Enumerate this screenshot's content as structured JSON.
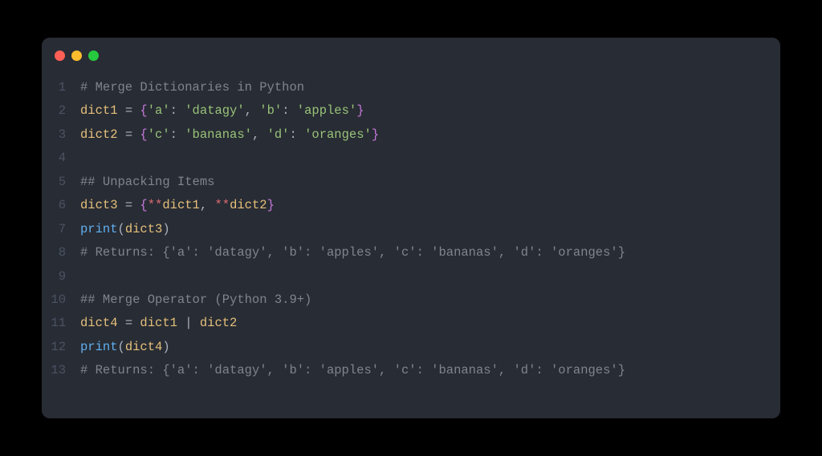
{
  "window": {
    "traffic_lights": [
      "red",
      "yellow",
      "green"
    ]
  },
  "code": {
    "lines": [
      {
        "n": "1",
        "tokens": [
          [
            "comment",
            "# Merge Dictionaries in Python"
          ]
        ]
      },
      {
        "n": "2",
        "tokens": [
          [
            "name",
            "dict1"
          ],
          [
            "op",
            " = "
          ],
          [
            "brace",
            "{"
          ],
          [
            "string",
            "'a'"
          ],
          [
            "punc",
            ": "
          ],
          [
            "string",
            "'datagy'"
          ],
          [
            "punc",
            ", "
          ],
          [
            "string",
            "'b'"
          ],
          [
            "punc",
            ": "
          ],
          [
            "string",
            "'apples'"
          ],
          [
            "brace",
            "}"
          ]
        ]
      },
      {
        "n": "3",
        "tokens": [
          [
            "name",
            "dict2"
          ],
          [
            "op",
            " = "
          ],
          [
            "brace",
            "{"
          ],
          [
            "string",
            "'c'"
          ],
          [
            "punc",
            ": "
          ],
          [
            "string",
            "'bananas'"
          ],
          [
            "punc",
            ", "
          ],
          [
            "string",
            "'d'"
          ],
          [
            "punc",
            ": "
          ],
          [
            "string",
            "'oranges'"
          ],
          [
            "brace",
            "}"
          ]
        ]
      },
      {
        "n": "4",
        "tokens": []
      },
      {
        "n": "5",
        "tokens": [
          [
            "comment",
            "## Unpacking Items"
          ]
        ]
      },
      {
        "n": "6",
        "tokens": [
          [
            "name",
            "dict3"
          ],
          [
            "op",
            " = "
          ],
          [
            "brace",
            "{"
          ],
          [
            "star",
            "**"
          ],
          [
            "name",
            "dict1"
          ],
          [
            "punc",
            ", "
          ],
          [
            "star",
            "**"
          ],
          [
            "name",
            "dict2"
          ],
          [
            "brace",
            "}"
          ]
        ]
      },
      {
        "n": "7",
        "tokens": [
          [
            "func",
            "print"
          ],
          [
            "punc",
            "("
          ],
          [
            "name",
            "dict3"
          ],
          [
            "punc",
            ")"
          ]
        ]
      },
      {
        "n": "8",
        "tokens": [
          [
            "comment",
            "# Returns: {'a': 'datagy', 'b': 'apples', 'c': 'bananas', 'd': 'oranges'}"
          ]
        ]
      },
      {
        "n": "9",
        "tokens": []
      },
      {
        "n": "10",
        "tokens": [
          [
            "comment",
            "## Merge Operator (Python 3.9+)"
          ]
        ]
      },
      {
        "n": "11",
        "tokens": [
          [
            "name",
            "dict4"
          ],
          [
            "op",
            " = "
          ],
          [
            "name",
            "dict1"
          ],
          [
            "pipe",
            " | "
          ],
          [
            "name",
            "dict2"
          ]
        ]
      },
      {
        "n": "12",
        "tokens": [
          [
            "func",
            "print"
          ],
          [
            "punc",
            "("
          ],
          [
            "name",
            "dict4"
          ],
          [
            "punc",
            ")"
          ]
        ]
      },
      {
        "n": "13",
        "tokens": [
          [
            "comment",
            "# Returns: {'a': 'datagy', 'b': 'apples', 'c': 'bananas', 'd': 'oranges'}"
          ]
        ]
      }
    ]
  }
}
